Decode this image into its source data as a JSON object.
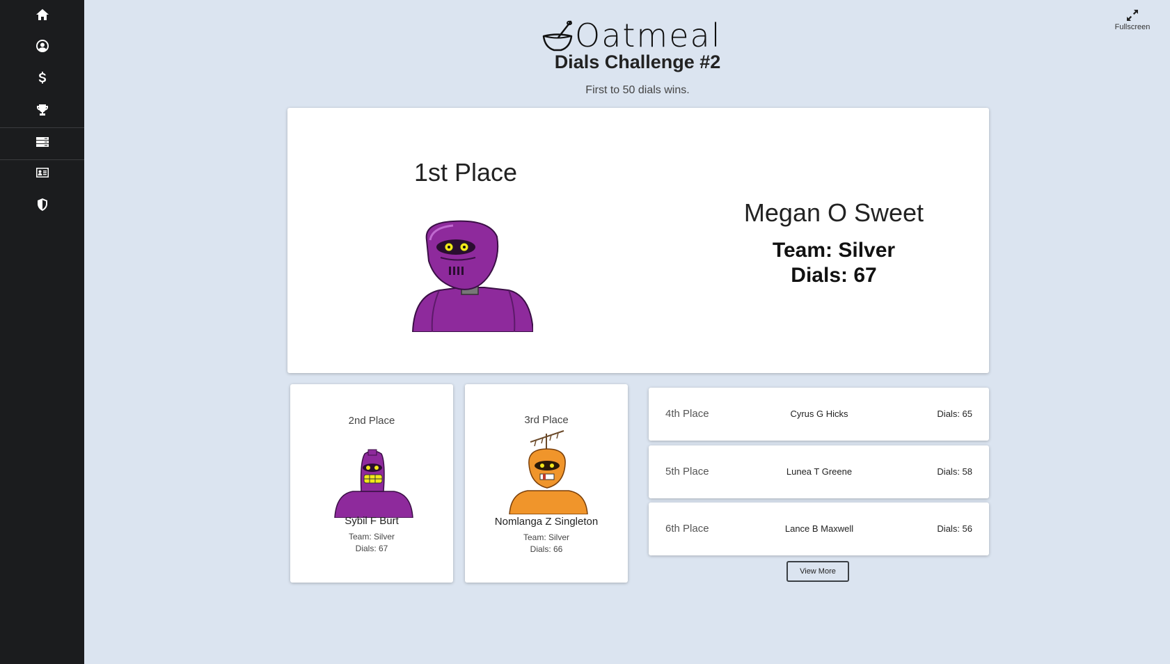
{
  "sidebar": {
    "icons": [
      "home-icon",
      "user-circle-icon",
      "dollar-icon",
      "trophy-icon",
      "server-icon",
      "id-card-icon",
      "shield-icon"
    ]
  },
  "header": {
    "logo_text": "Oatmeal",
    "title": "Dials Challenge #2",
    "subtitle": "First to 50 dials wins.",
    "fullscreen_label": "Fullscreen"
  },
  "first": {
    "place": "1st Place",
    "name": "Megan O Sweet",
    "team": "Team: Silver",
    "dials": "Dials: 67",
    "robot_color": "#8e2a9c"
  },
  "podium": [
    {
      "place": "2nd Place",
      "name": "Sybil F Burt",
      "team": "Team: Silver",
      "dials": "Dials: 67",
      "robot_color": "#8e2a9c"
    },
    {
      "place": "3rd Place",
      "name": "Nomlanga Z Singleton",
      "team": "Team: Silver",
      "dials": "Dials: 66",
      "robot_color": "#f0952b"
    }
  ],
  "ranks": [
    {
      "place": "4th Place",
      "name": "Cyrus G Hicks",
      "dials": "Dials: 65"
    },
    {
      "place": "5th Place",
      "name": "Lunea T Greene",
      "dials": "Dials: 58"
    },
    {
      "place": "6th Place",
      "name": "Lance B Maxwell",
      "dials": "Dials: 56"
    }
  ],
  "view_more_label": "View More",
  "colors": {
    "background": "#dbe4f0",
    "sidebar": "#1b1c1e",
    "purple": "#8e2a9c",
    "orange": "#f0952b"
  }
}
